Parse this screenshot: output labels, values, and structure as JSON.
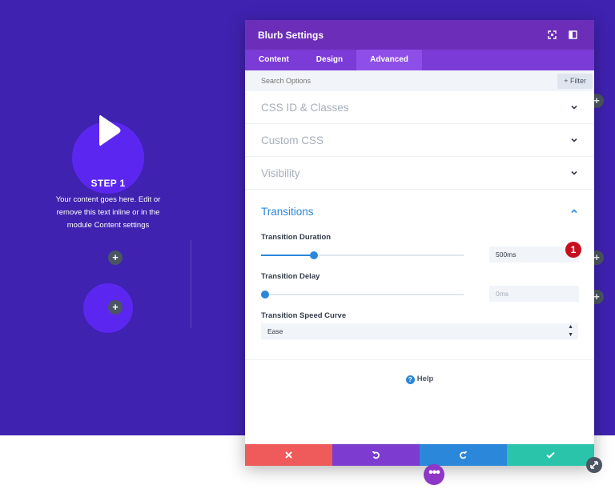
{
  "blurb": {
    "title": "STEP 1",
    "text": "Your content goes here. Edit or remove this text inline or in the module Content settings",
    "add_symbol": "+"
  },
  "modal": {
    "title": "Blurb Settings",
    "tabs": [
      {
        "label": "Content",
        "active": false
      },
      {
        "label": "Design",
        "active": false
      },
      {
        "label": "Advanced",
        "active": true
      }
    ],
    "search_placeholder": "Search Options",
    "filter_label": "+ Filter",
    "sections": [
      {
        "label": "CSS ID & Classes",
        "expanded": false
      },
      {
        "label": "Custom CSS",
        "expanded": false
      },
      {
        "label": "Visibility",
        "expanded": false
      }
    ],
    "transitions": {
      "label": "Transitions",
      "expanded": true,
      "duration": {
        "label": "Transition Duration",
        "value": "500ms",
        "slider_fraction": 0.26
      },
      "delay": {
        "label": "Transition Delay",
        "placeholder": "0ms",
        "slider_fraction": 0.0
      },
      "curve": {
        "label": "Transition Speed Curve",
        "value": "Ease"
      }
    },
    "help_label": "Help",
    "footer": {
      "cancel_color": "#ef5a5a",
      "undo_color": "#7e3bd0",
      "redo_color": "#2b87da",
      "save_color": "#29c4a9"
    }
  },
  "annotation_badge": "1",
  "more_symbol": "•••",
  "colors": {
    "canvas": "#3f22b0",
    "modal_header": "#6c2eb9",
    "accent_blue": "#2b87da"
  }
}
